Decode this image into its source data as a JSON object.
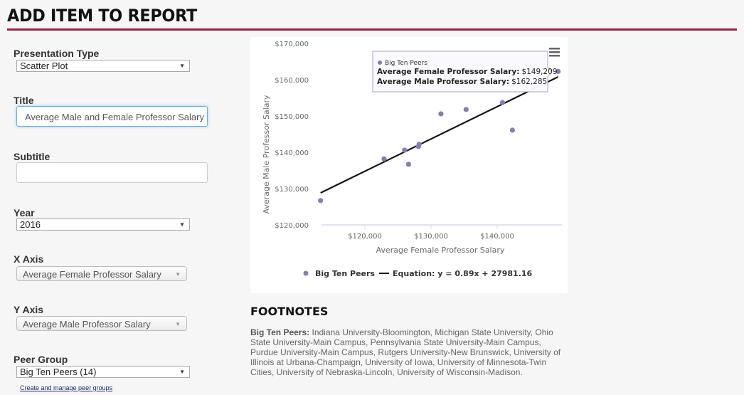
{
  "page": {
    "title": "ADD ITEM TO REPORT",
    "accent_color": "#9b1f4d"
  },
  "form": {
    "presentation_type": {
      "label": "Presentation Type",
      "value": "Scatter Plot"
    },
    "title": {
      "label": "Title",
      "value": "Average Male and Female Professor Salary"
    },
    "subtitle": {
      "label": "Subtitle",
      "value": ""
    },
    "year": {
      "label": "Year",
      "value": "2016"
    },
    "x_axis": {
      "label": "X Axis",
      "value": "Average Female Professor Salary"
    },
    "y_axis": {
      "label": "Y Axis",
      "value": "Average Male Professor Salary"
    },
    "peer_group": {
      "label": "Peer Group",
      "value": "Big Ten Peers (14)"
    },
    "manage_link": "Create and manage peer groups"
  },
  "chart_data": {
    "type": "scatter",
    "title": "",
    "xlabel": "Average Female Professor Salary",
    "ylabel": "Average Male Professor Salary",
    "xlim": [
      112000,
      150000
    ],
    "ylim": [
      120000,
      170000
    ],
    "x_ticks": [
      120000,
      130000,
      140000
    ],
    "x_tick_labels": [
      "$120,000",
      "$130,000",
      "$140,000"
    ],
    "y_ticks": [
      120000,
      130000,
      140000,
      150000,
      160000,
      170000
    ],
    "y_tick_labels": [
      "$120,000",
      "$130,000",
      "$140,000",
      "$150,000",
      "$160,000",
      "$170,000"
    ],
    "grid": false,
    "legend_position": "bottom",
    "series": [
      {
        "name": "Big Ten Peers",
        "color": "#8a7bb3",
        "points": [
          [
            113300,
            126700
          ],
          [
            122900,
            138200
          ],
          [
            126000,
            140600
          ],
          [
            126600,
            136700
          ],
          [
            128100,
            141600
          ],
          [
            128200,
            142200
          ],
          [
            131500,
            150600
          ],
          [
            135300,
            151800
          ],
          [
            140800,
            153700
          ],
          [
            142300,
            146100
          ],
          [
            149209,
            162285
          ]
        ]
      }
    ],
    "trendline": {
      "name": "Equation: y = 0.89x + 27981.16",
      "slope": 0.89,
      "intercept": 27981.16,
      "x_range": [
        113300,
        149209
      ],
      "color": "#111111"
    },
    "tooltip": {
      "series": "Big Ten Peers",
      "x_label": "Average Female Professor Salary",
      "x_value": "$149,209",
      "y_label": "Average Male Professor Salary",
      "y_value": "$162,285"
    },
    "legend": [
      "Big Ten Peers",
      "Equation: y = 0.89x + 27981.16"
    ]
  },
  "footnotes": {
    "title": "FOOTNOTES",
    "group_name": "Big Ten Peers:",
    "members": "Indiana University-Bloomington, Michigan State University, Ohio State University-Main Campus, Pennsylvania State University-Main Campus, Purdue University-Main Campus, Rutgers University-New Brunswick, University of Illinois at Urbana-Champaign, University of Iowa, University of Minnesota-Twin Cities, University of Nebraska-Lincoln, University of Wisconsin-Madison."
  }
}
